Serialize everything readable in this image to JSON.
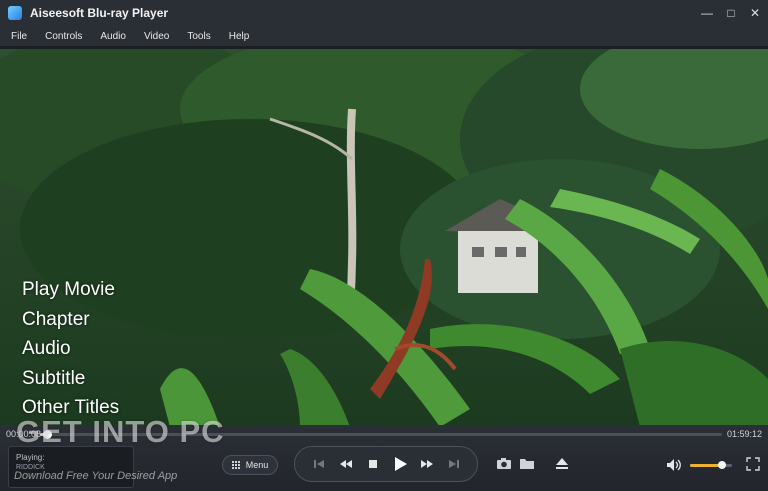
{
  "window": {
    "title": "Aiseesoft Blu-ray Player",
    "controls": [
      "minimize",
      "maximize",
      "close"
    ],
    "minimize_glyph": "—",
    "maximize_glyph": "□",
    "close_glyph": "✕"
  },
  "menubar": {
    "items": [
      "File",
      "Controls",
      "Audio",
      "Video",
      "Tools",
      "Help"
    ]
  },
  "disc_menu": {
    "items": [
      "Play Movie",
      "Chapter",
      "Audio",
      "Subtitle",
      "Other Titles"
    ]
  },
  "playback": {
    "elapsed": "00:00:08",
    "duration": "01:59:12",
    "progress": 0.01,
    "now_playing_label": "Playing:",
    "now_playing_title": "RIDDICK",
    "menu_label": "Menu",
    "volume": 0.75
  },
  "icons": {
    "menu": "grid-icon",
    "prev": "skip-previous-icon",
    "rewind": "rewind-icon",
    "stop": "stop-icon",
    "play": "play-icon",
    "forward": "fast-forward-icon",
    "next": "skip-next-icon",
    "snapshot": "camera-icon",
    "open": "folder-icon",
    "eject": "eject-icon",
    "volume": "volume-icon",
    "fullscreen": "fullscreen-icon"
  },
  "colors": {
    "accent_volume": "#f0b030",
    "bar": "#2a2e35"
  },
  "watermark": {
    "main": "GET INTO PC",
    "sub": "Download Free Your Desired App"
  }
}
